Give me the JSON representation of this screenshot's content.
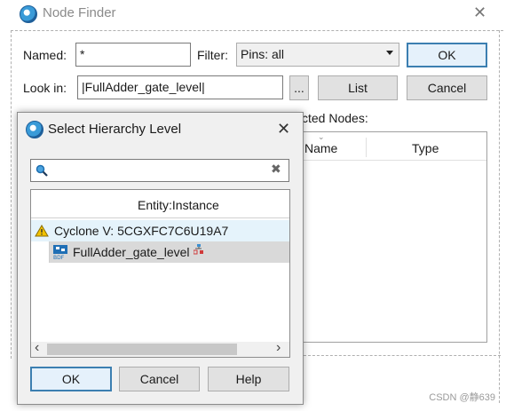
{
  "window": {
    "title": "Node Finder",
    "close_glyph": "✕"
  },
  "form": {
    "named_label": "Named:",
    "named_value": "*",
    "filter_label": "Filter:",
    "filter_value": "Pins: all",
    "lookin_label": "Look in:",
    "lookin_value": "|FullAdder_gate_level|",
    "browse_label": "...",
    "ok_label": "OK",
    "list_label": "List",
    "cancel_label": "Cancel",
    "selected_nodes_label": "cted Nodes:"
  },
  "results": {
    "columns": [
      "Name",
      "Type"
    ]
  },
  "dialog": {
    "title": "Select Hierarchy Level",
    "close_glyph": "✕",
    "search": {
      "value": "",
      "clear_glyph": "✖"
    },
    "tree_header": "Entity:Instance",
    "tree": [
      {
        "label": "Cyclone V: 5CGXFC7C6U19A7",
        "icon": "device-warning-icon"
      },
      {
        "label": "FullAdder_gate_level",
        "icon": "bdf-file-icon",
        "extra_icon": "hierarchy-icon",
        "selected": true
      }
    ],
    "scroll_left": "‹",
    "scroll_right": "›",
    "buttons": {
      "ok": "OK",
      "cancel": "Cancel",
      "help": "Help"
    }
  },
  "watermark": "CSDN @静639",
  "colors": {
    "accent": "#3c7fb1",
    "selection": "#d9d9d9",
    "highlight_row": "#e5f3fb"
  }
}
